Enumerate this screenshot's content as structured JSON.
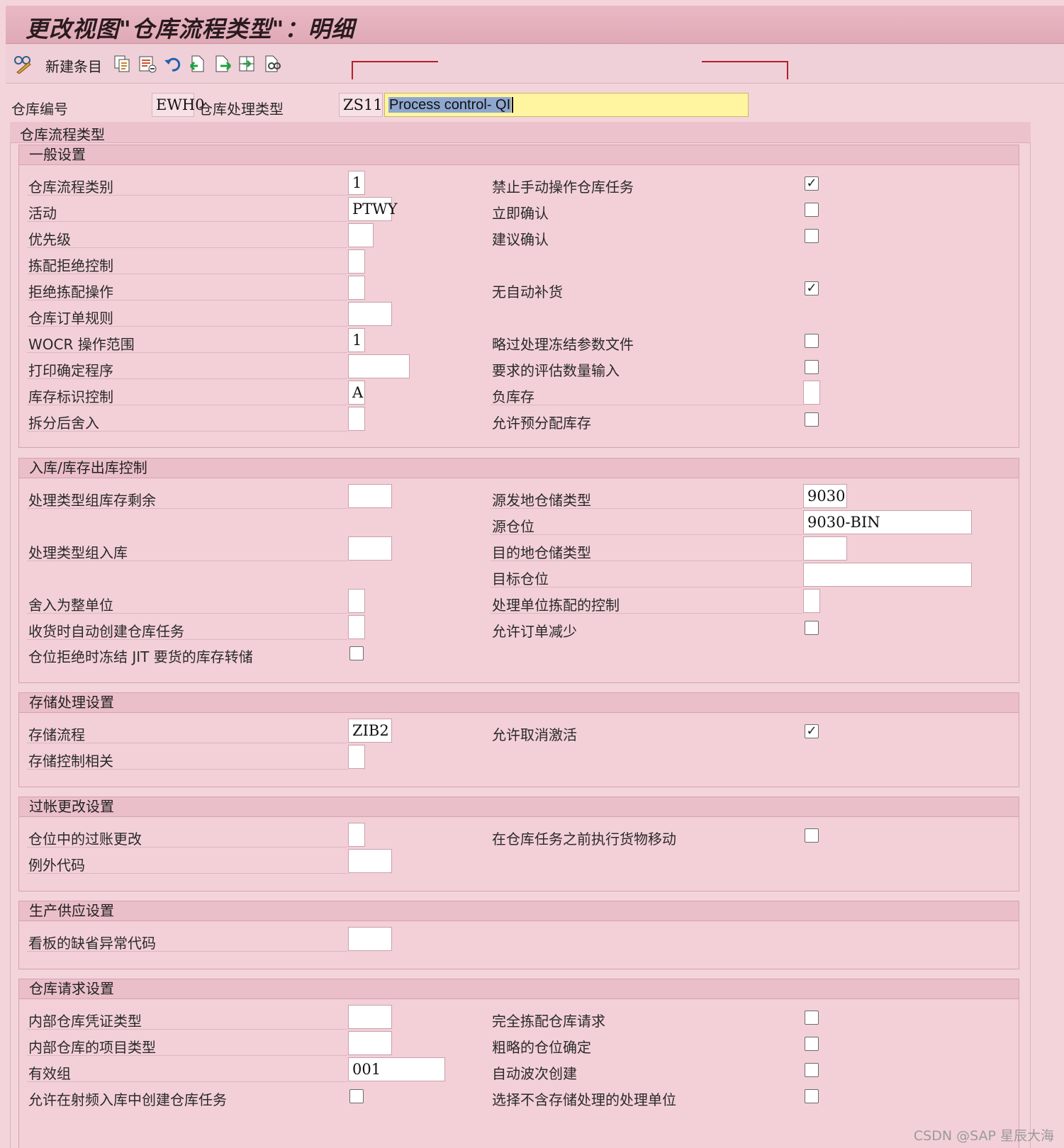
{
  "window": {
    "title": "更改视图\"仓库流程类型\"：明细"
  },
  "toolbar": {
    "new_entries_label": "新建条目",
    "icons": [
      "glasses-pencil-icon",
      "copy-icon",
      "delete-icon",
      "undo-icon",
      "previous-entry-icon",
      "next-entry-icon",
      "select-all-icon",
      "other-entry-icon"
    ]
  },
  "header": {
    "warehouse_label": "仓库编号",
    "warehouse_value": "EWH0",
    "proc_type_label": "仓库处理类型",
    "proc_type_value": "ZS11",
    "proc_type_desc_selected": "Process control- QI"
  },
  "section": {
    "title": "仓库流程类型"
  },
  "general": {
    "title": "一般设置",
    "left": [
      {
        "label": "仓库流程类别",
        "value": "1"
      },
      {
        "label": "活动",
        "value": "PTWY"
      },
      {
        "label": "优先级",
        "value": ""
      },
      {
        "label": "拣配拒绝控制",
        "value": ""
      },
      {
        "label": "拒绝拣配操作",
        "value": ""
      },
      {
        "label": "仓库订单规则",
        "value": ""
      },
      {
        "label": "WOCR 操作范围",
        "value": "1"
      },
      {
        "label": "打印确定程序",
        "value": ""
      },
      {
        "label": "库存标识控制",
        "value": "A"
      },
      {
        "label": "拆分后舍入",
        "value": ""
      }
    ],
    "right": [
      {
        "label": "禁止手动操作仓库任务",
        "checked": "✓"
      },
      {
        "label": "立即确认",
        "checked": ""
      },
      {
        "label": "建议确认",
        "checked": ""
      },
      {
        "label": "无自动补货",
        "checked": "✓"
      },
      {
        "label": "略过处理冻结参数文件",
        "checked": ""
      },
      {
        "label": "要求的评估数量输入",
        "checked": ""
      },
      {
        "label": "负库存",
        "value": ""
      },
      {
        "label": "允许预分配库存",
        "checked": ""
      }
    ]
  },
  "inbound": {
    "title": "入库/库存出库控制",
    "left": [
      {
        "label": "处理类型组库存剩余",
        "value": ""
      },
      {
        "label": "处理类型组入库",
        "value": ""
      },
      {
        "label": "舍入为整单位",
        "value": ""
      },
      {
        "label": "收货时自动创建仓库任务",
        "value": ""
      },
      {
        "label": "仓位拒绝时冻结 JIT 要货的库存转储",
        "checked": ""
      }
    ],
    "right": [
      {
        "label": "源发地仓储类型",
        "value": "9030"
      },
      {
        "label": "源仓位",
        "value": "9030-BIN"
      },
      {
        "label": "目的地仓储类型",
        "value": ""
      },
      {
        "label": "目标仓位",
        "value": ""
      },
      {
        "label": "处理单位拣配的控制",
        "value": ""
      },
      {
        "label": "允许订单减少",
        "checked": ""
      }
    ]
  },
  "storage": {
    "title": "存储处理设置",
    "left": [
      {
        "label": "存储流程",
        "value": "ZIB2"
      },
      {
        "label": "存储控制相关",
        "value": ""
      }
    ],
    "right": [
      {
        "label": "允许取消激活",
        "checked": "✓"
      }
    ]
  },
  "posting": {
    "title": "过帐更改设置",
    "left": [
      {
        "label": "仓位中的过账更改",
        "value": ""
      },
      {
        "label": "例外代码",
        "value": ""
      }
    ],
    "right": [
      {
        "label": "在仓库任务之前执行货物移动",
        "checked": ""
      }
    ]
  },
  "production": {
    "title": "生产供应设置",
    "left": [
      {
        "label": "看板的缺省异常代码",
        "value": ""
      }
    ]
  },
  "request": {
    "title": "仓库请求设置",
    "left": [
      {
        "label": "内部仓库凭证类型",
        "value": ""
      },
      {
        "label": "内部仓库的项目类型",
        "value": ""
      },
      {
        "label": "有效组",
        "value": "001"
      },
      {
        "label": "允许在射频入库中创建仓库任务",
        "checked": ""
      }
    ],
    "right": [
      {
        "label": "完全拣配仓库请求",
        "checked": ""
      },
      {
        "label": "粗略的仓位确定",
        "checked": ""
      },
      {
        "label": "自动波次创建",
        "checked": ""
      },
      {
        "label": "选择不含存储处理的处理单位",
        "checked": ""
      }
    ]
  },
  "watermark": "CSDN @SAP 星辰大海"
}
